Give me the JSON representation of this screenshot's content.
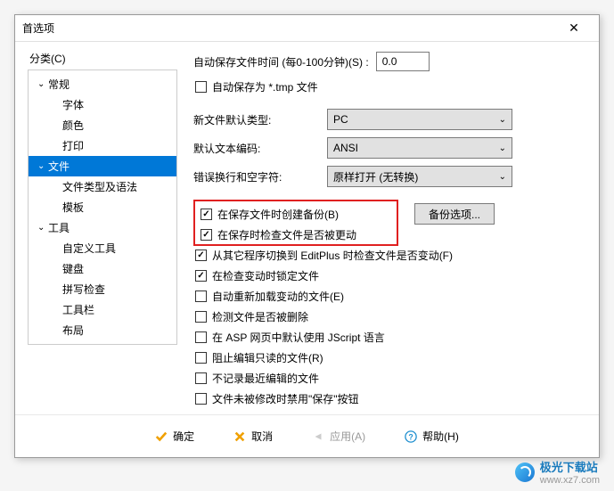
{
  "window": {
    "title": "首选项"
  },
  "sidebar": {
    "label": "分类(C)",
    "items": [
      {
        "label": "常规",
        "expanded": true
      },
      {
        "label": "字体"
      },
      {
        "label": "颜色"
      },
      {
        "label": "打印"
      },
      {
        "label": "文件",
        "expanded": true,
        "selected": true
      },
      {
        "label": "文件类型及语法"
      },
      {
        "label": "模板"
      },
      {
        "label": "工具",
        "expanded": true
      },
      {
        "label": "自定义工具"
      },
      {
        "label": "键盘"
      },
      {
        "label": "拼写检查"
      },
      {
        "label": "工具栏"
      },
      {
        "label": "布局"
      }
    ]
  },
  "main": {
    "autosave_label": "自动保存文件时间 (每0-100分钟)(S) :",
    "autosave_value": "0.0",
    "autosave_tmp": "自动保存为 *.tmp 文件",
    "new_file_type_label": "新文件默认类型:",
    "new_file_type_value": "PC",
    "default_encoding_label": "默认文本编码:",
    "default_encoding_value": "ANSI",
    "wrap_label": "错误换行和空字符:",
    "wrap_value": "原样打开 (无转换)",
    "backup_button": "备份选项...",
    "checks": [
      {
        "label": "在保存文件时创建备份(B)",
        "checked": true
      },
      {
        "label": "在保存时检查文件是否被更动",
        "checked": true
      },
      {
        "label": "从其它程序切换到 EditPlus 时检查文件是否变动(F)",
        "checked": true
      },
      {
        "label": "在检查变动时锁定文件",
        "checked": true
      },
      {
        "label": "自动重新加载变动的文件(E)",
        "checked": false
      },
      {
        "label": "检测文件是否被删除",
        "checked": false
      },
      {
        "label": "在 ASP 网页中默认使用 JScript 语言",
        "checked": false
      },
      {
        "label": "阻止编辑只读的文件(R)",
        "checked": false
      },
      {
        "label": "不记录最近编辑的文件",
        "checked": false
      },
      {
        "label": "文件未被修改时禁用\"保存\"按钮",
        "checked": false
      }
    ]
  },
  "footer": {
    "ok": "确定",
    "cancel": "取消",
    "apply": "应用(A)",
    "help": "帮助(H)"
  },
  "watermark": {
    "name": "极光下载站",
    "url": "www.xz7.com"
  }
}
